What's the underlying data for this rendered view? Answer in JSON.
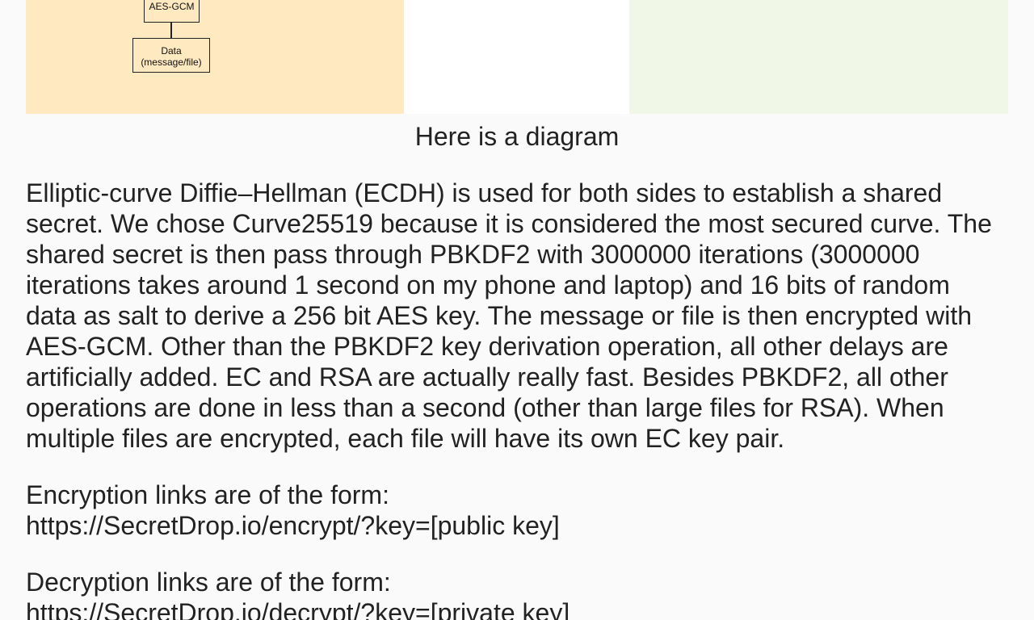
{
  "diagram": {
    "aes_node_label": "AES-GCM",
    "data_node_line1": "Data",
    "data_node_line2": "(message/file)"
  },
  "caption": "Here is a diagram",
  "paragraphs": {
    "main": "Elliptic-curve Diffie–Hellman (ECDH) is used for both sides to establish a shared secret. We chose Curve25519 because it is considered the most secured curve. The shared secret is then pass through PBKDF2 with 3000000 iterations (3000000 iterations takes around 1 second on my phone and laptop) and 16 bits of random data as salt to derive a 256 bit AES key. The message or file is then encrypted with AES-GCM. Other than the PBKDF2 key derivation operation, all other delays are artificially added. EC and RSA are actually really fast. Besides PBKDF2, all other operations are done in less than a second (other than large files for RSA). When multiple files are encrypted, each file will have its own EC key pair.",
    "encryption_intro": "Encryption links are of the form:",
    "encryption_link": "https://SecretDrop.io/encrypt/?key=[public key]",
    "decryption_intro": "Decryption links are of the form:",
    "decryption_link": "https://SecretDrop.io/decrypt/?key=[private key]"
  },
  "colors": {
    "left_panel": "#ffe9c1",
    "right_panel": "#f0f7e6",
    "background": "#fafafa",
    "text": "#222222"
  }
}
